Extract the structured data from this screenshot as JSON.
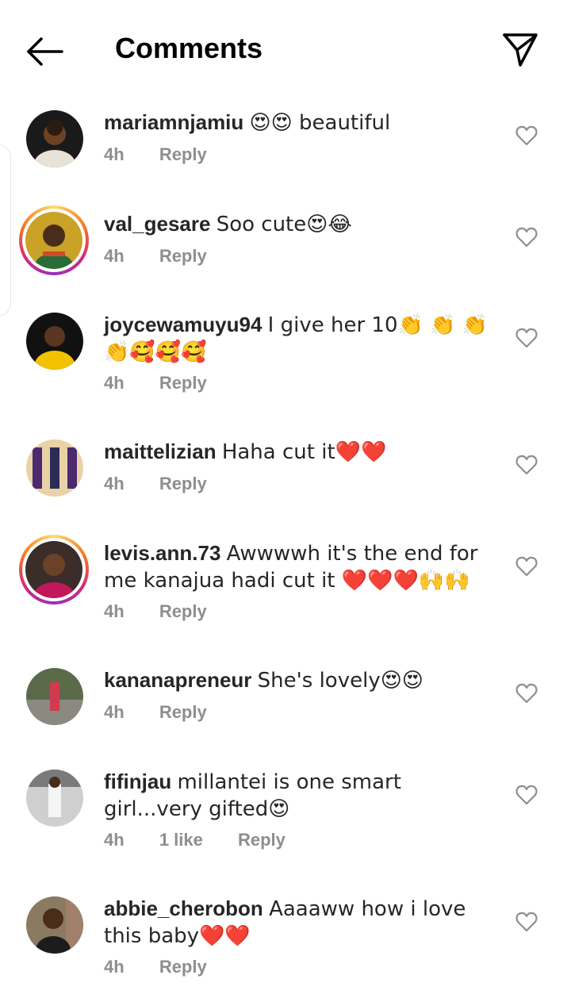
{
  "header": {
    "title": "Comments",
    "back_icon": "arrow-left-icon",
    "share_icon": "paper-plane-icon"
  },
  "comments": [
    {
      "username": "mariamnjamiu",
      "text": "😍😍 beautiful",
      "time": "4h",
      "likes": "",
      "reply": "Reply",
      "story_ring": false
    },
    {
      "username": "val_gesare",
      "text": "Soo cute😍😂",
      "time": "4h",
      "likes": "",
      "reply": "Reply",
      "story_ring": true
    },
    {
      "username": "joycewamuyu94",
      "text": "I give her 10👏 👏 👏 👏🥰🥰🥰",
      "time": "4h",
      "likes": "",
      "reply": "Reply",
      "story_ring": false
    },
    {
      "username": "maittelizian",
      "text": "Haha cut it❤️❤️",
      "time": "4h",
      "likes": "",
      "reply": "Reply",
      "story_ring": false
    },
    {
      "username": "levis.ann.73",
      "text": "Awwwwh it's the end for me kanajua hadi cut it ❤️❤️❤️🙌🙌",
      "time": "4h",
      "likes": "",
      "reply": "Reply",
      "story_ring": true
    },
    {
      "username": "kananapreneur",
      "text": "She's lovely😍😍",
      "time": "4h",
      "likes": "",
      "reply": "Reply",
      "story_ring": false
    },
    {
      "username": "fifinjau",
      "text": "millantei is one smart girl...very gifted😍",
      "time": "4h",
      "likes": "1 like",
      "reply": "Reply",
      "story_ring": false
    },
    {
      "username": "abbie_cherobon",
      "text": "Aaaaww how i love this baby❤️❤️",
      "time": "4h",
      "likes": "",
      "reply": "Reply",
      "story_ring": false
    }
  ],
  "colors": {
    "text": "#262626",
    "meta": "#8e8e8e",
    "story_ring": [
      "#feda75",
      "#fa7e1e",
      "#d62976",
      "#962fbf"
    ]
  },
  "icons": {
    "like": "heart-outline-icon"
  }
}
